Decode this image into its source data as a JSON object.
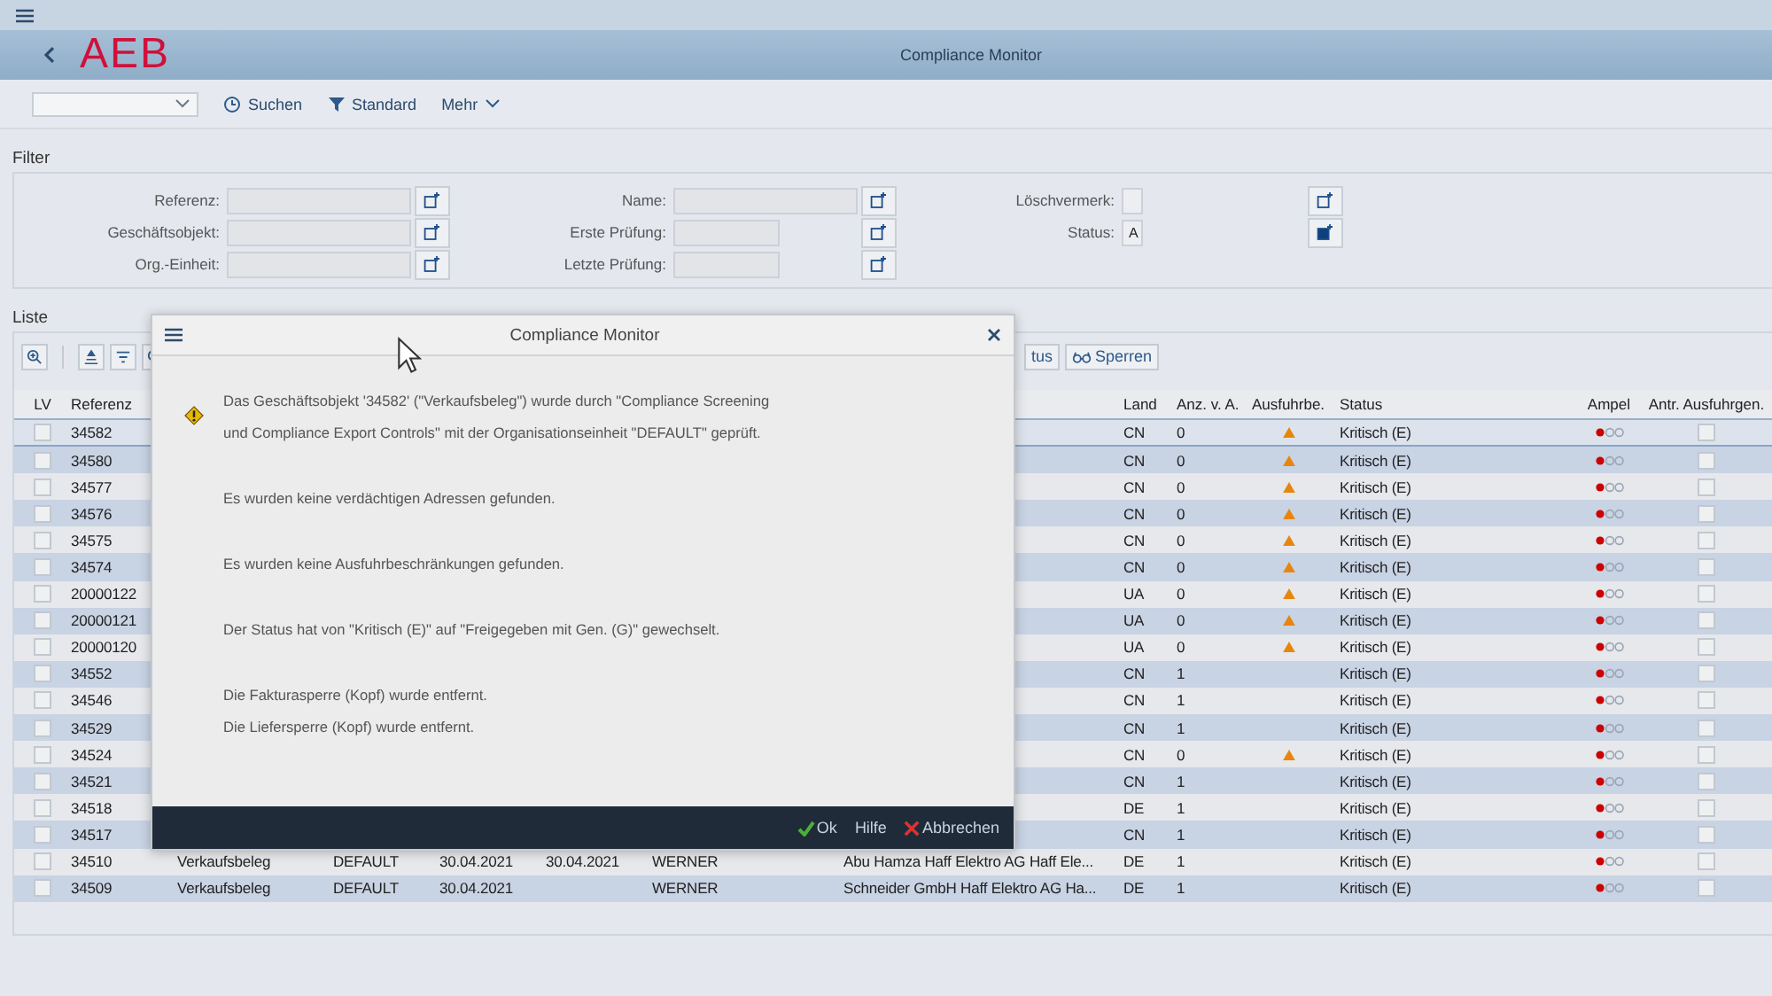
{
  "shell": {
    "logo": "AEB",
    "title": "Compliance Monitor"
  },
  "toolbar": {
    "buttons": [
      {
        "kind": "search",
        "label": "Suchen"
      },
      {
        "kind": "filter",
        "label": "Standard"
      },
      {
        "kind": "more",
        "label": "Mehr"
      }
    ]
  },
  "filter": {
    "title": "Filter",
    "columns": [
      [
        {
          "label": "Referenz:",
          "kind": "text",
          "multi_active": false
        },
        {
          "label": "Geschäftsobjekt:",
          "kind": "text",
          "multi_active": false
        },
        {
          "label": "Org.-Einheit:",
          "kind": "text",
          "multi_active": false
        }
      ],
      [
        {
          "label": "Name:",
          "kind": "text",
          "multi_active": false
        },
        {
          "label": "Erste Prüfung:",
          "kind": "date",
          "multi_active": false
        },
        {
          "label": "Letzte Prüfung:",
          "kind": "date",
          "multi_active": false
        }
      ],
      [
        {
          "label": "Löschvermerk:",
          "kind": "flag",
          "multi_active": false
        },
        {
          "label": "Status:",
          "kind": "flag",
          "value": "A",
          "multi_active": true
        }
      ]
    ]
  },
  "list": {
    "title": "Liste",
    "buttons": [
      {
        "label": "tus"
      },
      {
        "label": "Sperren"
      }
    ],
    "columns": [
      "LV",
      "Referenz",
      "Land",
      "Anz. v. A.",
      "Ausfuhrbe.",
      "Status",
      "Ampel",
      "Antr. Ausfuhrgen."
    ],
    "rows": [
      {
        "selected": true,
        "checked": false,
        "ref": "34582",
        "land": "CN",
        "count": "0",
        "warning": true,
        "status": "Kritisch (E)",
        "color": "#cc0000",
        "approval": false
      },
      {
        "selected": false,
        "checked": false,
        "ref": "34580",
        "land": "CN",
        "count": "0",
        "warning": true,
        "status": "Kritisch (E)",
        "color": "#cc0000",
        "approval": false
      },
      {
        "selected": false,
        "checked": false,
        "ref": "34577",
        "land": "CN",
        "count": "0",
        "warning": true,
        "status": "Kritisch (E)",
        "color": "#cc0000",
        "approval": false
      },
      {
        "selected": false,
        "checked": false,
        "ref": "34576",
        "land": "CN",
        "count": "0",
        "warning": true,
        "status": "Kritisch (E)",
        "color": "#cc0000",
        "approval": false
      },
      {
        "selected": false,
        "checked": false,
        "ref": "34575",
        "land": "CN",
        "count": "0",
        "warning": true,
        "status": "Kritisch (E)",
        "color": "#cc0000",
        "approval": false
      },
      {
        "selected": false,
        "checked": false,
        "ref": "34574",
        "land": "CN",
        "count": "0",
        "warning": true,
        "status": "Kritisch (E)",
        "color": "#cc0000",
        "approval": false
      },
      {
        "selected": false,
        "checked": false,
        "ref": "20000122",
        "land": "UA",
        "count": "0",
        "warning": true,
        "status": "Kritisch (E)",
        "color": "#cc0000",
        "approval": false
      },
      {
        "selected": false,
        "checked": false,
        "ref": "20000121",
        "land": "UA",
        "count": "0",
        "warning": true,
        "status": "Kritisch (E)",
        "color": "#cc0000",
        "approval": false
      },
      {
        "selected": false,
        "checked": false,
        "ref": "20000120",
        "land": "UA",
        "count": "0",
        "warning": true,
        "status": "Kritisch (E)",
        "color": "#cc0000",
        "approval": false
      },
      {
        "selected": false,
        "checked": false,
        "ref": "34552",
        "land": "CN",
        "count": "1",
        "warning": false,
        "status": "Kritisch (E)",
        "color": "#cc0000",
        "approval": false
      },
      {
        "selected": false,
        "checked": false,
        "ref": "34546",
        "land": "CN",
        "count": "1",
        "warning": false,
        "status": "Kritisch (E)",
        "color": "#cc0000",
        "approval": false
      },
      {
        "selected": false,
        "checked": false,
        "ref": "34529",
        "land": "CN",
        "count": "1",
        "warning": false,
        "status": "Kritisch (E)",
        "color": "#cc0000",
        "approval": false
      },
      {
        "selected": false,
        "checked": false,
        "ref": "34524",
        "land": "CN",
        "count": "0",
        "warning": true,
        "status": "Kritisch (E)",
        "color": "#cc0000",
        "approval": false
      },
      {
        "selected": false,
        "checked": false,
        "ref": "34521",
        "land": "CN",
        "count": "1",
        "warning": false,
        "status": "Kritisch (E)",
        "color": "#cc0000",
        "approval": false
      },
      {
        "selected": false,
        "checked": false,
        "ref": "34518",
        "land": "DE",
        "count": "1",
        "warning": false,
        "status": "Kritisch (E)",
        "color": "#cc0000",
        "approval": false
      },
      {
        "selected": false,
        "checked": false,
        "ref": "34517",
        "land": "CN",
        "count": "1",
        "warning": false,
        "status": "Kritisch (E)",
        "color": "#cc0000",
        "approval": false
      },
      {
        "selected": false,
        "checked": false,
        "ref": "34510",
        "type": "Verkaufsbeleg",
        "org": "DEFAULT",
        "date1": "30.04.2021",
        "date2": "30.04.2021",
        "user": "WERNER",
        "name": "Abu Hamza Haff Elektro AG Haff Ele...",
        "land": "DE",
        "count": "1",
        "warning": false,
        "status": "Kritisch (E)",
        "color": "#cc0000",
        "approval": false
      },
      {
        "selected": false,
        "checked": false,
        "ref": "34509",
        "type": "Verkaufsbeleg",
        "org": "DEFAULT",
        "date1": "30.04.2021",
        "user": "WERNER",
        "name": "Schneider GmbH Haff Elektro AG Ha...",
        "land": "DE",
        "count": "1",
        "warning": false,
        "status": "Kritisch (E)",
        "color": "#cc0000",
        "approval": false
      }
    ]
  },
  "dialog": {
    "title": "Compliance Monitor",
    "kind": "warning",
    "messages": [
      "Das Geschäftsobjekt '34582' (\"Verkaufsbeleg\") wurde durch \"Compliance Screening\nund Compliance Export Controls\" mit der Organisationseinheit \"DEFAULT\" geprüft.",
      "Es wurden keine verdächtigen Adressen gefunden.",
      "Es wurden keine Ausfuhrbeschränkungen gefunden.",
      "Der Status hat von \"Kritisch (E)\" auf \"Freigegeben mit Gen. (G)\" gewechselt.",
      "Die Fakturasperre (Kopf) wurde entfernt.\nDie Liefersperre (Kopf) wurde entfernt."
    ],
    "buttons": [
      {
        "kind": "ok",
        "label": "Ok"
      },
      {
        "kind": "plain",
        "label": "Hilfe"
      },
      {
        "kind": "cancel",
        "label": "Abbrechen"
      }
    ]
  }
}
